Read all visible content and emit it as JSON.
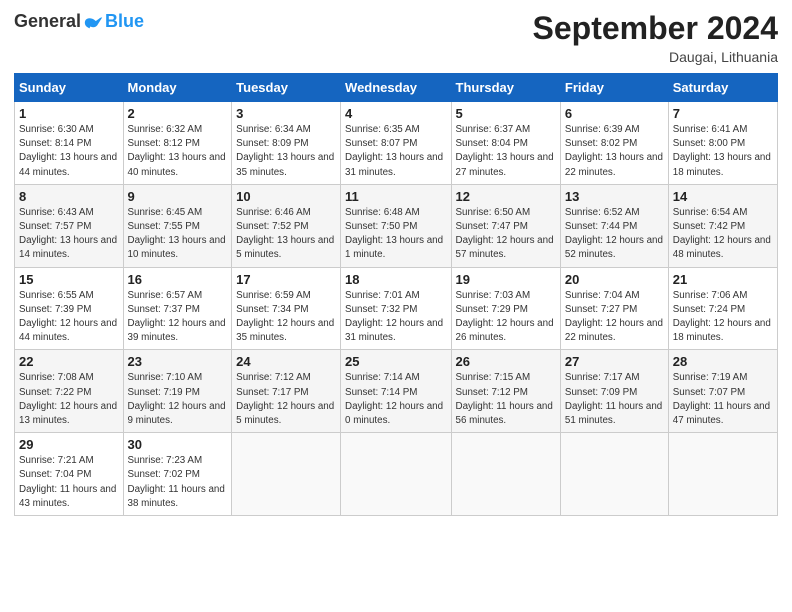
{
  "header": {
    "logo": {
      "general": "General",
      "blue": "Blue"
    },
    "title": "September 2024",
    "location": "Daugai, Lithuania"
  },
  "calendar": {
    "headers": [
      "Sunday",
      "Monday",
      "Tuesday",
      "Wednesday",
      "Thursday",
      "Friday",
      "Saturday"
    ],
    "weeks": [
      [
        null,
        null,
        null,
        null,
        null,
        null,
        null
      ]
    ],
    "days": {
      "1": {
        "sunrise": "6:30 AM",
        "sunset": "8:14 PM",
        "daylight": "13 hours and 44 minutes."
      },
      "2": {
        "sunrise": "6:32 AM",
        "sunset": "8:12 PM",
        "daylight": "13 hours and 40 minutes."
      },
      "3": {
        "sunrise": "6:34 AM",
        "sunset": "8:09 PM",
        "daylight": "13 hours and 35 minutes."
      },
      "4": {
        "sunrise": "6:35 AM",
        "sunset": "8:07 PM",
        "daylight": "13 hours and 31 minutes."
      },
      "5": {
        "sunrise": "6:37 AM",
        "sunset": "8:04 PM",
        "daylight": "13 hours and 27 minutes."
      },
      "6": {
        "sunrise": "6:39 AM",
        "sunset": "8:02 PM",
        "daylight": "13 hours and 22 minutes."
      },
      "7": {
        "sunrise": "6:41 AM",
        "sunset": "8:00 PM",
        "daylight": "13 hours and 18 minutes."
      },
      "8": {
        "sunrise": "6:43 AM",
        "sunset": "7:57 PM",
        "daylight": "13 hours and 14 minutes."
      },
      "9": {
        "sunrise": "6:45 AM",
        "sunset": "7:55 PM",
        "daylight": "13 hours and 10 minutes."
      },
      "10": {
        "sunrise": "6:46 AM",
        "sunset": "7:52 PM",
        "daylight": "13 hours and 5 minutes."
      },
      "11": {
        "sunrise": "6:48 AM",
        "sunset": "7:50 PM",
        "daylight": "13 hours and 1 minute."
      },
      "12": {
        "sunrise": "6:50 AM",
        "sunset": "7:47 PM",
        "daylight": "12 hours and 57 minutes."
      },
      "13": {
        "sunrise": "6:52 AM",
        "sunset": "7:44 PM",
        "daylight": "12 hours and 52 minutes."
      },
      "14": {
        "sunrise": "6:54 AM",
        "sunset": "7:42 PM",
        "daylight": "12 hours and 48 minutes."
      },
      "15": {
        "sunrise": "6:55 AM",
        "sunset": "7:39 PM",
        "daylight": "12 hours and 44 minutes."
      },
      "16": {
        "sunrise": "6:57 AM",
        "sunset": "7:37 PM",
        "daylight": "12 hours and 39 minutes."
      },
      "17": {
        "sunrise": "6:59 AM",
        "sunset": "7:34 PM",
        "daylight": "12 hours and 35 minutes."
      },
      "18": {
        "sunrise": "7:01 AM",
        "sunset": "7:32 PM",
        "daylight": "12 hours and 31 minutes."
      },
      "19": {
        "sunrise": "7:03 AM",
        "sunset": "7:29 PM",
        "daylight": "12 hours and 26 minutes."
      },
      "20": {
        "sunrise": "7:04 AM",
        "sunset": "7:27 PM",
        "daylight": "12 hours and 22 minutes."
      },
      "21": {
        "sunrise": "7:06 AM",
        "sunset": "7:24 PM",
        "daylight": "12 hours and 18 minutes."
      },
      "22": {
        "sunrise": "7:08 AM",
        "sunset": "7:22 PM",
        "daylight": "12 hours and 13 minutes."
      },
      "23": {
        "sunrise": "7:10 AM",
        "sunset": "7:19 PM",
        "daylight": "12 hours and 9 minutes."
      },
      "24": {
        "sunrise": "7:12 AM",
        "sunset": "7:17 PM",
        "daylight": "12 hours and 5 minutes."
      },
      "25": {
        "sunrise": "7:14 AM",
        "sunset": "7:14 PM",
        "daylight": "12 hours and 0 minutes."
      },
      "26": {
        "sunrise": "7:15 AM",
        "sunset": "7:12 PM",
        "daylight": "11 hours and 56 minutes."
      },
      "27": {
        "sunrise": "7:17 AM",
        "sunset": "7:09 PM",
        "daylight": "11 hours and 51 minutes."
      },
      "28": {
        "sunrise": "7:19 AM",
        "sunset": "7:07 PM",
        "daylight": "11 hours and 47 minutes."
      },
      "29": {
        "sunrise": "7:21 AM",
        "sunset": "7:04 PM",
        "daylight": "11 hours and 43 minutes."
      },
      "30": {
        "sunrise": "7:23 AM",
        "sunset": "7:02 PM",
        "daylight": "11 hours and 38 minutes."
      }
    }
  }
}
